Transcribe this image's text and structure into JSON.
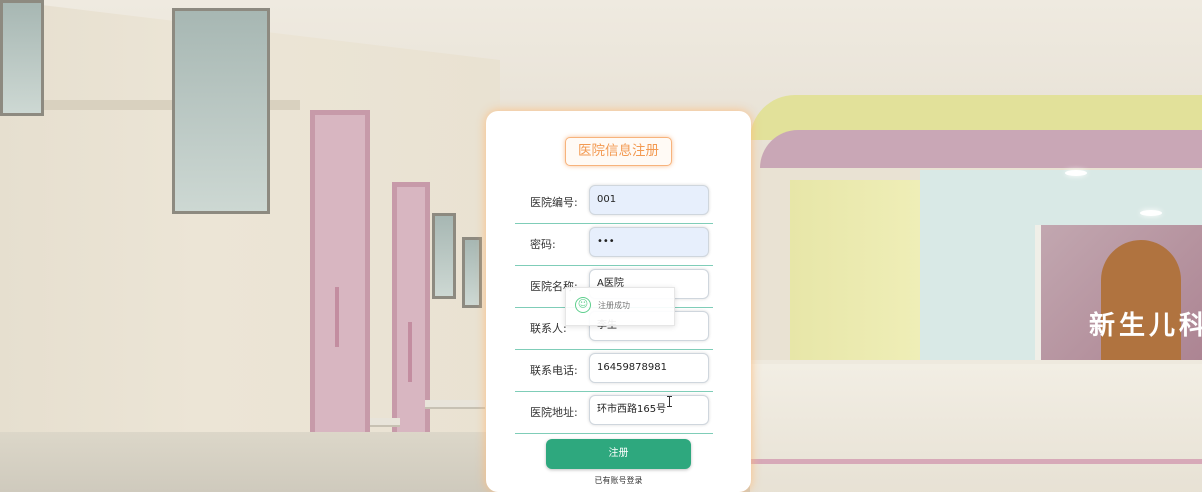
{
  "form": {
    "title": "医院信息注册",
    "fields": [
      {
        "label": "医院编号:",
        "value": "001"
      },
      {
        "label": "密码:",
        "value": "•••"
      },
      {
        "label": "医院名称:",
        "value": "A医院"
      },
      {
        "label": "联系人:",
        "value": "李生"
      },
      {
        "label": "联系电话:",
        "value": "16459878981"
      },
      {
        "label": "医院地址:",
        "value": "环市西路165号"
      }
    ],
    "submit_label": "注册",
    "login_link": "已有账号登录"
  },
  "toast": {
    "icon": "smile-icon",
    "message": "注册成功"
  },
  "mural_text": "新生儿科"
}
